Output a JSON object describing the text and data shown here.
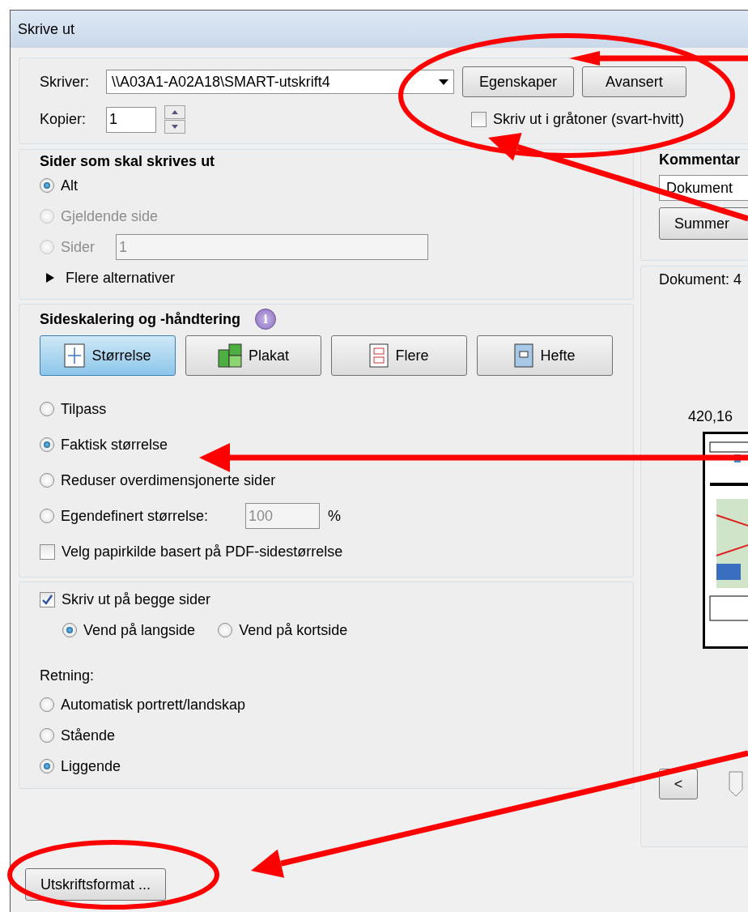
{
  "window": {
    "title": "Skrive ut"
  },
  "printer": {
    "label": "Skriver:",
    "value": "\\\\A03A1-A02A18\\SMART-utskrift4",
    "properties_button": "Egenskaper",
    "advanced_button": "Avansert",
    "copies_label": "Kopier:",
    "copies_value": "1",
    "grayscale": {
      "label": "Skriv ut i gråtoner (svart-hvitt)",
      "checked": false
    }
  },
  "pages": {
    "title": "Sider som skal skrives ut",
    "options": [
      {
        "kind": "plain",
        "label": "Alt",
        "selected": true,
        "disabled": false
      },
      {
        "kind": "plain",
        "label": "Gjeldende side",
        "selected": false,
        "disabled": true
      },
      {
        "kind": "range",
        "label": "Sider",
        "selected": false,
        "disabled": true,
        "value": "1"
      }
    ],
    "more_options": "Flere alternativer"
  },
  "scaling": {
    "title": "Sideskalering og -håndtering",
    "info_mark": "i",
    "modes": [
      {
        "label": "Størrelse",
        "selected": true
      },
      {
        "label": "Plakat",
        "selected": false
      },
      {
        "label": "Flere",
        "selected": false
      },
      {
        "label": "Hefte",
        "selected": false
      }
    ],
    "options": [
      {
        "kind": "plain",
        "label": "Tilpass",
        "selected": false
      },
      {
        "kind": "plain",
        "label": "Faktisk størrelse",
        "selected": true
      },
      {
        "kind": "plain",
        "label": "Reduser overdimensjonerte sider",
        "selected": false
      },
      {
        "kind": "custom",
        "label": "Egendefinert størrelse:",
        "selected": false,
        "value": "100",
        "unit": "%"
      }
    ],
    "paper_source": {
      "label": "Velg papirkilde basert på PDF-sidestørrelse",
      "checked": false
    }
  },
  "duplex": {
    "label": "Skriv ut på begge sider",
    "checked": true,
    "options": [
      {
        "label": "Vend på langside",
        "selected": true
      },
      {
        "label": "Vend på kortside",
        "selected": false
      }
    ]
  },
  "orientation": {
    "label": "Retning:",
    "options": [
      {
        "label": "Automatisk portrett/landskap",
        "selected": false
      },
      {
        "label": "Stående",
        "selected": false
      },
      {
        "label": "Liggende",
        "selected": true
      }
    ]
  },
  "comments": {
    "title": "Kommentar",
    "dropdown": "Dokument",
    "button": "Summer"
  },
  "preview": {
    "document_label": "Dokument: 4",
    "size": "420,16",
    "prev_button": "<"
  },
  "page_setup_button": "Utskriftsformat ..."
}
